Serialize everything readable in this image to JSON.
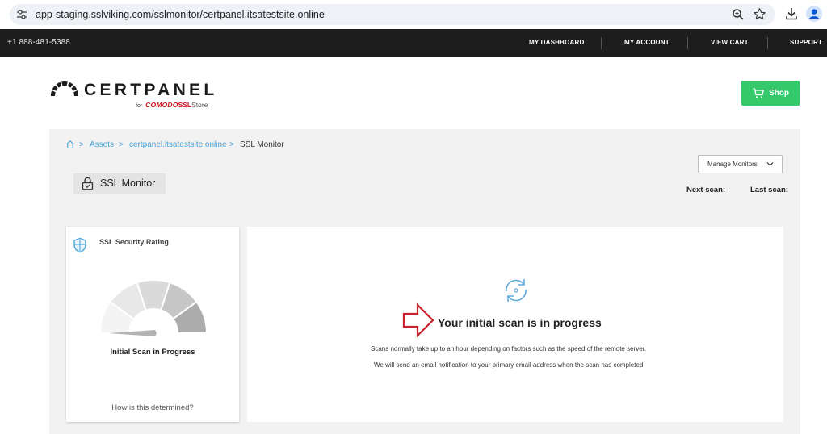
{
  "browser": {
    "url": "app-staging.sslviking.com/sslmonitor/certpanel.itsatestsite.online"
  },
  "topnav": {
    "phone": "+1 888-481-5388",
    "links": [
      "MY DASHBOARD",
      "MY ACCOUNT",
      "VIEW CART",
      "SUPPORT"
    ]
  },
  "logo": {
    "name": "CERTPANEL",
    "for": "for",
    "comodo": "COMODO",
    "ssl": "SSL",
    "store": "Store"
  },
  "shop": {
    "label": "Shop"
  },
  "breadcrumb": {
    "sep": ">",
    "items": [
      "Assets",
      "certpanel.itsatestsite.online",
      "SSL Monitor"
    ]
  },
  "page": {
    "title": "SSL Monitor",
    "manage_label": "Manage Monitors",
    "next_scan_label": "Next scan:",
    "last_scan_label": "Last scan:"
  },
  "rating": {
    "header": "SSL Security Rating",
    "status": "Initial Scan in Progress",
    "how_link": "How is this determined?",
    "gauge_colors": [
      "#f4f4f4",
      "#e8e8e8",
      "#dadada",
      "#c6c6c6",
      "#acacac"
    ]
  },
  "progress": {
    "headline": "Your initial scan is in progress",
    "message1": "Scans normally take up to an hour depending on factors such as the speed of the remote server.",
    "message2": "We will send an email notification to your primary email address when the scan has completed"
  },
  "colors": {
    "accent_blue": "#4aa3d8",
    "shop_green": "#36c96c",
    "nav_bg": "#1d1d1d",
    "arrow_red": "#c8232c"
  },
  "icons": [
    "tune-icon",
    "zoom-icon",
    "star-icon",
    "download-icon",
    "profile-icon",
    "logo-mark-icon",
    "cart-icon",
    "home-icon",
    "lock-icon",
    "chevron-down-icon",
    "shield-icon",
    "sync-icon",
    "arrow-right-icon"
  ]
}
